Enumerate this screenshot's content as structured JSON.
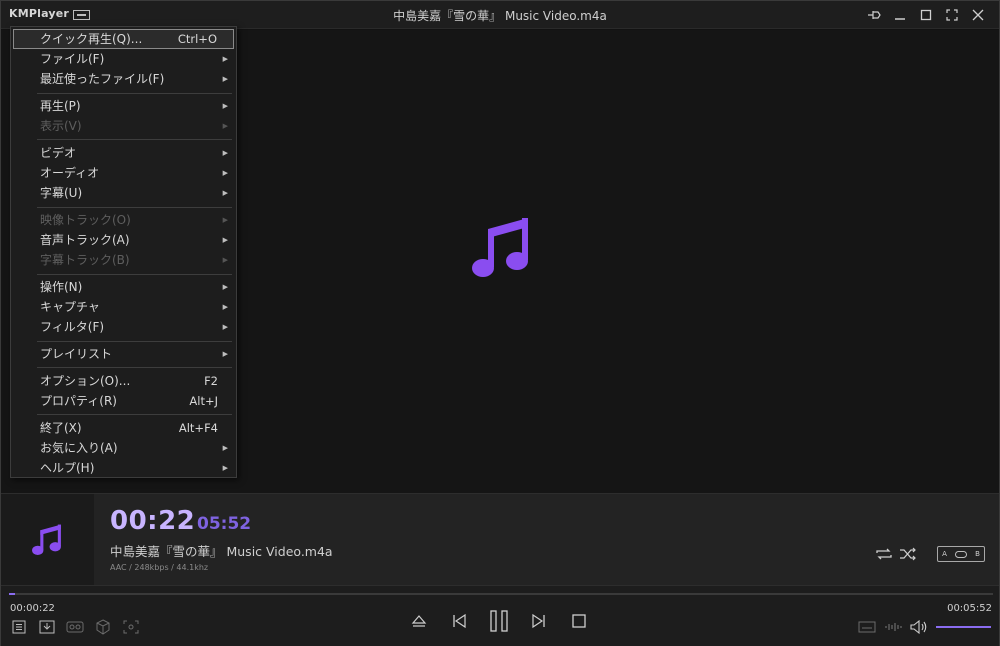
{
  "app": {
    "logo": "KMPlayer",
    "title": "中島美嘉『雪の華』 Music Video.m4a"
  },
  "menu": {
    "items": [
      {
        "label": "クイック再生(Q)...",
        "shortcut": "Ctrl+O",
        "submenu": false,
        "enabled": true,
        "highlighted": true
      },
      {
        "label": "ファイル(F)",
        "shortcut": "",
        "submenu": true,
        "enabled": true
      },
      {
        "label": "最近使ったファイル(F)",
        "shortcut": "",
        "submenu": true,
        "enabled": true
      },
      {
        "separator": true
      },
      {
        "label": "再生(P)",
        "shortcut": "",
        "submenu": true,
        "enabled": true
      },
      {
        "label": "表示(V)",
        "shortcut": "",
        "submenu": true,
        "enabled": false
      },
      {
        "separator": true
      },
      {
        "label": "ビデオ",
        "shortcut": "",
        "submenu": true,
        "enabled": true
      },
      {
        "label": "オーディオ",
        "shortcut": "",
        "submenu": true,
        "enabled": true
      },
      {
        "label": "字幕(U)",
        "shortcut": "",
        "submenu": true,
        "enabled": true
      },
      {
        "separator": true
      },
      {
        "label": "映像トラック(O)",
        "shortcut": "",
        "submenu": true,
        "enabled": false
      },
      {
        "label": "音声トラック(A)",
        "shortcut": "",
        "submenu": true,
        "enabled": true
      },
      {
        "label": "字幕トラック(B)",
        "shortcut": "",
        "submenu": true,
        "enabled": false
      },
      {
        "separator": true
      },
      {
        "label": "操作(N)",
        "shortcut": "",
        "submenu": true,
        "enabled": true
      },
      {
        "label": "キャプチャ",
        "shortcut": "",
        "submenu": true,
        "enabled": true
      },
      {
        "label": "フィルタ(F)",
        "shortcut": "",
        "submenu": true,
        "enabled": true
      },
      {
        "separator": true
      },
      {
        "label": "プレイリスト",
        "shortcut": "",
        "submenu": true,
        "enabled": true
      },
      {
        "separator": true
      },
      {
        "label": "オプション(O)...",
        "shortcut": "F2",
        "submenu": false,
        "enabled": true
      },
      {
        "label": "プロパティ(R)",
        "shortcut": "Alt+J",
        "submenu": false,
        "enabled": true
      },
      {
        "separator": true
      },
      {
        "label": "終了(X)",
        "shortcut": "Alt+F4",
        "submenu": false,
        "enabled": true
      },
      {
        "label": "お気に入り(A)",
        "shortcut": "",
        "submenu": true,
        "enabled": true
      },
      {
        "label": "ヘルプ(H)",
        "shortcut": "",
        "submenu": true,
        "enabled": true
      }
    ]
  },
  "info": {
    "current_time": "00:22",
    "total_time": "05:52",
    "track_name": "中島美嘉『雪の華』 Music Video.m4a",
    "meta": "AAC / 248kbps / 44.1khz",
    "ab_labels": {
      "a": "A",
      "b": "B"
    }
  },
  "controls": {
    "elapsed": "00:00:22",
    "duration": "00:05:52",
    "progress_fraction": 0.0065,
    "volume_fraction": 1.0
  },
  "colors": {
    "accent": "#8a6cf0",
    "accent_light": "#c8b4ff"
  },
  "icons": [
    "eject-icon",
    "previous-icon",
    "pause-icon",
    "next-icon",
    "stop-icon",
    "repeat-icon",
    "shuffle-icon",
    "volume-icon",
    "music-note-icon",
    "playlist-icon",
    "download-icon",
    "vr-icon",
    "3d-cube-icon",
    "capture-icon",
    "subtitle-icon",
    "equalizer-icon",
    "pin-icon",
    "minimize-icon",
    "maximize-icon",
    "fullscreen-icon",
    "close-icon"
  ]
}
